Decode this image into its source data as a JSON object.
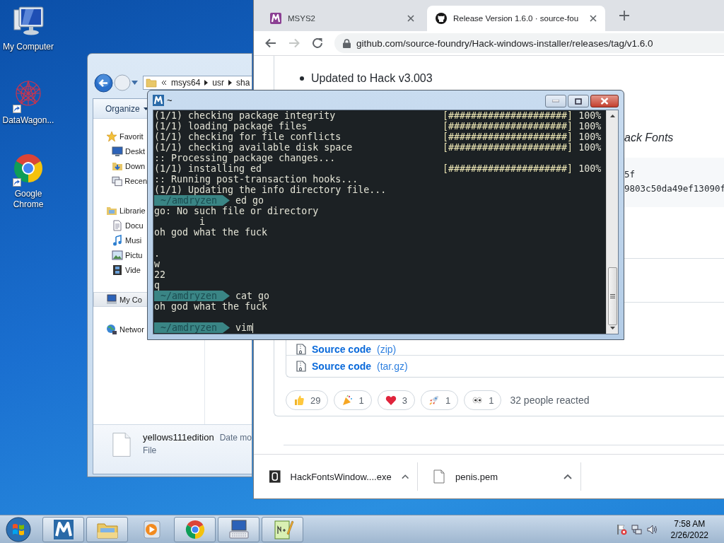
{
  "desktop_icons": [
    {
      "label": "My Computer",
      "kind": "computer",
      "shortcut": false
    },
    {
      "label": "DataWagon...",
      "kind": "web",
      "shortcut": true
    },
    {
      "label": "Google Chrome",
      "kind": "chrome",
      "shortcut": true
    }
  ],
  "explorer": {
    "breadcrumb": [
      "msys64",
      "usr",
      "sha"
    ],
    "toolbar": "Organize",
    "nav": [
      {
        "label": "Favorit",
        "kind": "star",
        "selected": false,
        "children": [
          {
            "label": "Deskt",
            "kind": "desktop",
            "selected": false
          },
          {
            "label": "Down",
            "kind": "downloads",
            "selected": false
          },
          {
            "label": "Recen",
            "kind": "recent",
            "selected": false
          }
        ]
      },
      {
        "label": "Librarie",
        "kind": "library",
        "selected": false,
        "children": [
          {
            "label": "Docu",
            "kind": "documents",
            "selected": false
          },
          {
            "label": "Musi",
            "kind": "music",
            "selected": false
          },
          {
            "label": "Pictu",
            "kind": "pictures",
            "selected": false
          },
          {
            "label": "Vide",
            "kind": "videos",
            "selected": false
          }
        ]
      },
      {
        "label": "My Co",
        "kind": "computer",
        "selected": true
      },
      {
        "label": "Networ",
        "kind": "network",
        "selected": false
      }
    ],
    "details": {
      "name": "yellows111edition",
      "column": "Date mo",
      "type": "File"
    }
  },
  "browser": {
    "tabs": [
      {
        "title": "MSYS2",
        "kind": "msys",
        "selected": false
      },
      {
        "title": "Release Version 1.6.0 · source-fou",
        "kind": "github",
        "selected": true
      }
    ],
    "nav_buttons": [
      {
        "kind": "back",
        "disabled": false
      },
      {
        "kind": "forward",
        "disabled": true
      },
      {
        "kind": "reload",
        "disabled": false
      }
    ],
    "url": "github.com/source-foundry/Hack-windows-installer/releases/tag/v1.6.0",
    "notes": [
      "Updated to Hack v3.003"
    ],
    "heading": "ack Fonts",
    "hash_lines": [
      "5f",
      "9803c50da49ef13090f"
    ],
    "assets": [
      {
        "name": "Source code",
        "format": "(zip)"
      },
      {
        "name": "Source code",
        "format": "(tar.gz)"
      }
    ],
    "reactions": [
      {
        "kind": "thumbs_up",
        "count": "29"
      },
      {
        "kind": "party",
        "count": "1"
      },
      {
        "kind": "heart",
        "count": "3"
      },
      {
        "kind": "rocket",
        "count": "1"
      },
      {
        "kind": "eyes",
        "count": "1"
      }
    ],
    "reacted": "32 people reacted",
    "downloads": [
      {
        "name": "HackFontsWindow....exe",
        "kind": "exe"
      },
      {
        "name": "penis.pem",
        "kind": "file"
      }
    ]
  },
  "terminal": {
    "title": "~",
    "lines": [
      {
        "kind": "progress",
        "text": "(1/1) checking package integrity",
        "bar": "[#####################]",
        "percent": "100%"
      },
      {
        "kind": "progress",
        "text": "(1/1) loading package files",
        "bar": "[#####################]",
        "percent": "100%"
      },
      {
        "kind": "progress",
        "text": "(1/1) checking for file conflicts",
        "bar": "[#####################]",
        "percent": "100%"
      },
      {
        "kind": "progress",
        "text": "(1/1) checking available disk space",
        "bar": "[#####################]",
        "percent": "100%"
      },
      {
        "kind": "text",
        "text": ":: Processing package changes..."
      },
      {
        "kind": "progress",
        "text": "(1/1) installing ed",
        "bar": "[#####################]",
        "percent": "100%"
      },
      {
        "kind": "text",
        "text": ":: Running post-transaction hooks..."
      },
      {
        "kind": "text",
        "text": "(1/1) Updating the info directory file..."
      },
      {
        "kind": "prompt",
        "path": "~/amdryzen",
        "command": "ed go",
        "cursor": false
      },
      {
        "kind": "text",
        "text": "go: No such file or directory"
      },
      {
        "kind": "text",
        "text": "        i"
      },
      {
        "kind": "text",
        "text": "oh god what the fuck"
      },
      {
        "kind": "blank"
      },
      {
        "kind": "text",
        "text": "."
      },
      {
        "kind": "text",
        "text": "w"
      },
      {
        "kind": "text",
        "text": "22"
      },
      {
        "kind": "text",
        "text": "q"
      },
      {
        "kind": "prompt",
        "path": "~/amdryzen",
        "command": "cat go",
        "cursor": false
      },
      {
        "kind": "text",
        "text": "oh god what the fuck"
      },
      {
        "kind": "blank"
      },
      {
        "kind": "prompt",
        "path": "~/amdryzen",
        "command": "vim",
        "cursor": true
      }
    ]
  },
  "taskbar": {
    "apps": [
      {
        "kind": "msys",
        "running": true
      },
      {
        "kind": "explorer",
        "running": true
      },
      {
        "kind": "media",
        "running": false
      },
      {
        "kind": "chrome",
        "running": true
      },
      {
        "kind": "keyboard",
        "running": true
      },
      {
        "kind": "notepad",
        "running": true
      }
    ],
    "time": "7:58 AM",
    "date": "2/26/2022"
  }
}
